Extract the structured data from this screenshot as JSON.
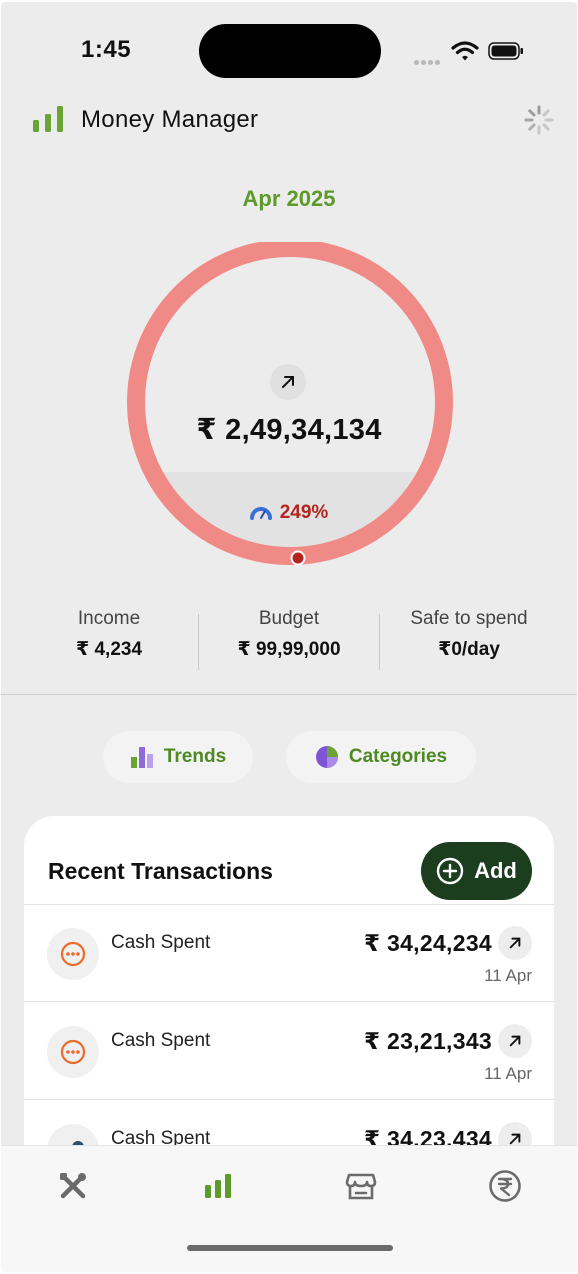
{
  "status_bar": {
    "time": "1:45"
  },
  "header": {
    "title": "Money Manager",
    "logo_icon": "bar-chart-icon",
    "refresh_icon": "spinner-icon"
  },
  "summary": {
    "month": "Apr 2025",
    "spent": "₹ 2,49,34,134",
    "percent": "249%",
    "progress_fraction": 2.49,
    "colors": {
      "ring": "#f08a86",
      "accent_green": "#5c9a2a",
      "percent_red": "#b3261e"
    }
  },
  "stats": [
    {
      "label": "Income",
      "value": "₹ 4,234"
    },
    {
      "label": "Budget",
      "value": "₹ 99,99,000"
    },
    {
      "label": "Safe to spend",
      "value": "₹0/day"
    }
  ],
  "actions": {
    "trends": "Trends",
    "categories": "Categories"
  },
  "transactions": {
    "title": "Recent Transactions",
    "add_label": "Add",
    "items": [
      {
        "name": "Cash Spent",
        "amount": "₹ 34,24,234",
        "date": "11 Apr",
        "icon": "more-dots-icon"
      },
      {
        "name": "Cash Spent",
        "amount": "₹ 23,21,343",
        "date": "11 Apr",
        "icon": "more-dots-icon"
      },
      {
        "name": "Cash Spent",
        "amount": "₹ 34,23,434",
        "date": "",
        "icon": "cash-icon"
      }
    ]
  },
  "tabbar": {
    "items": [
      {
        "name": "tools",
        "icon": "tools-icon",
        "active": false
      },
      {
        "name": "money-manager",
        "icon": "bar-chart-icon",
        "active": true
      },
      {
        "name": "store",
        "icon": "store-icon",
        "active": false
      },
      {
        "name": "rupee",
        "icon": "rupee-icon",
        "active": false
      }
    ]
  }
}
